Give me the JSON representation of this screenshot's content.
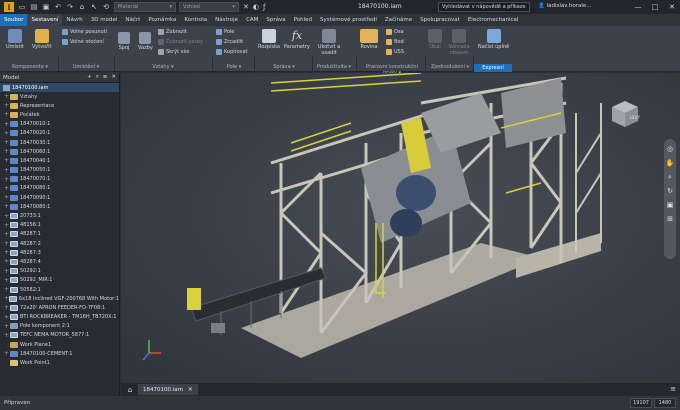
{
  "app": {
    "logo_letter": "I",
    "document_title": "18470100.iam",
    "search_placeholder": "Vyhledávat v nápovědě a příkaze",
    "user": "ladislav.horale...",
    "window_buttons": [
      "—",
      "□",
      "✕"
    ]
  },
  "quick_access": {
    "material_label": "Materiál",
    "appearance_label": "Vzhled"
  },
  "tabs": [
    {
      "label": "Soubor"
    },
    {
      "label": "Sestavení"
    },
    {
      "label": "Návrh"
    },
    {
      "label": "3D model"
    },
    {
      "label": "Náčrt"
    },
    {
      "label": "Poznámka"
    },
    {
      "label": "Kontrola"
    },
    {
      "label": "Nástroje"
    },
    {
      "label": "CAM"
    },
    {
      "label": "Správa"
    },
    {
      "label": "Pohled"
    },
    {
      "label": "Systémové prostředí"
    },
    {
      "label": "Začínáme"
    },
    {
      "label": "Spolupracovat"
    },
    {
      "label": "Electromechanical"
    }
  ],
  "ribbon": {
    "place": "Umístit",
    "create": "Vytvořit",
    "free_move": "Volné posunutí",
    "free_rotate": "Volné otočení",
    "join": "Spoj",
    "constrain": "Vazby",
    "show": "Zobrazit",
    "show_sick": "Zobrazit vazby",
    "hide_all": "Skrýt vše",
    "pattern": "Pole",
    "mirror": "Zrcadlit",
    "copy": "Kopírovat",
    "bom": "Rozpiska",
    "parameters": "Parametry",
    "ground_root": "Ukotvit a usadit",
    "plane": "Rovina",
    "axis": "Osa",
    "point": "Bod",
    "ucs": "USS",
    "shrinkwrap": "Obal",
    "substitute": "Náhrada obalem",
    "start_express": "Načíst úplně",
    "groups": {
      "component": "Komponenta",
      "position": "Umístění",
      "relationships": "Vztahy",
      "pattern": "Pole",
      "manage": "Správa",
      "productivity": "Produktivita",
      "work_features": "Pracovní konstrukční prvky",
      "simplification": "Zjednodušení",
      "express": "Expresní"
    }
  },
  "browser": {
    "title": "Model",
    "root": "18470100.iam",
    "nodes": [
      {
        "label": "Vztahy",
        "icon": "folder"
      },
      {
        "label": "Reprezentace",
        "icon": "folder"
      },
      {
        "label": "Počátek",
        "icon": "folder"
      },
      {
        "label": "18470010:1",
        "icon": "part"
      },
      {
        "label": "18470020:1",
        "icon": "part"
      },
      {
        "label": "18470030:1",
        "icon": "part"
      },
      {
        "label": "18470060:1",
        "icon": "part"
      },
      {
        "label": "18470040:1",
        "icon": "part"
      },
      {
        "label": "18470050:1",
        "icon": "part"
      },
      {
        "label": "18470070:1",
        "icon": "part"
      },
      {
        "label": "18470080:1",
        "icon": "part"
      },
      {
        "label": "18470090:1",
        "icon": "part"
      },
      {
        "label": "18470080:1",
        "icon": "part"
      },
      {
        "label": "20733:1",
        "icon": "asm"
      },
      {
        "label": "48156:1",
        "icon": "asm"
      },
      {
        "label": "48287:1",
        "icon": "asm"
      },
      {
        "label": "48287:2",
        "icon": "asm"
      },
      {
        "label": "48287:3",
        "icon": "asm"
      },
      {
        "label": "48287:4",
        "icon": "asm"
      },
      {
        "label": "50292:1",
        "icon": "asm"
      },
      {
        "label": "50292_MIR:1",
        "icon": "asm"
      },
      {
        "label": "50582:1",
        "icon": "asm"
      },
      {
        "label": "6x18 Inclined VGF-200768 With Motor:1",
        "icon": "asm"
      },
      {
        "label": "72x20' APRON FEEDER-FO-7F08:1",
        "icon": "asm"
      },
      {
        "label": "BTI ROCKBREAKER - TM16H_TB720X:1",
        "icon": "asm"
      },
      {
        "label": "Pole komponent 2:1",
        "icon": "weld"
      },
      {
        "label": "TEFC NEMA MOTOR_5877:1",
        "icon": "asm"
      },
      {
        "label": "Work Plane1",
        "icon": "plane"
      },
      {
        "label": "18470100-CEMENT:1",
        "icon": "part"
      },
      {
        "label": "Work Point1",
        "icon": "point"
      }
    ]
  },
  "document_tabs": [
    {
      "label": "18470100.iam"
    }
  ],
  "viewcube": {
    "face": "LEVÝ"
  },
  "status": {
    "text": "Připraven",
    "count1": "19107",
    "count2": "1480"
  },
  "colors": {
    "accent": "#1e6fb8",
    "structure": "#c7c3b6",
    "rails": "#d8d23a",
    "machine": "#3a4f70"
  }
}
